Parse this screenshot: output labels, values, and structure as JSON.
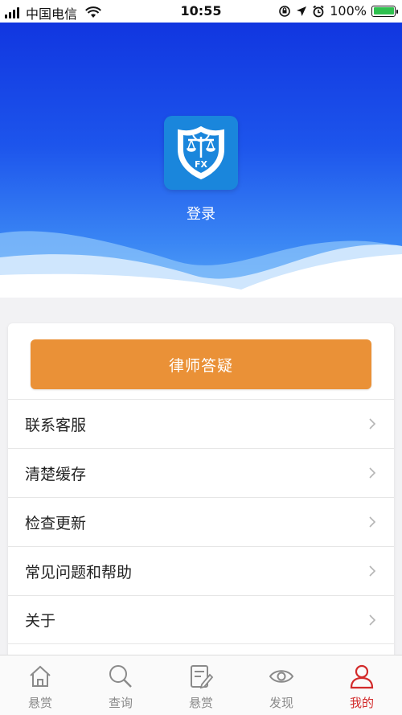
{
  "status_bar": {
    "carrier": "中国电信",
    "time": "10:55",
    "battery": "100%",
    "battery_level": 1.0
  },
  "header": {
    "login_label": "登录",
    "logo_text": "FX"
  },
  "card": {
    "consult_button": "律师答疑",
    "menu": [
      {
        "label": "联系客服"
      },
      {
        "label": "清楚缓存"
      },
      {
        "label": "检查更新"
      },
      {
        "label": "常见问题和帮助"
      },
      {
        "label": "关于"
      }
    ]
  },
  "tabbar": {
    "active_color": "#d22a2a",
    "inactive_color": "#8a8a8a",
    "tabs": [
      {
        "label": "悬赏",
        "icon": "home-icon"
      },
      {
        "label": "查询",
        "icon": "search-icon"
      },
      {
        "label": "悬赏",
        "icon": "edit-note-icon"
      },
      {
        "label": "发现",
        "icon": "eye-icon"
      },
      {
        "label": "我的",
        "icon": "user-icon",
        "active": true
      }
    ]
  }
}
